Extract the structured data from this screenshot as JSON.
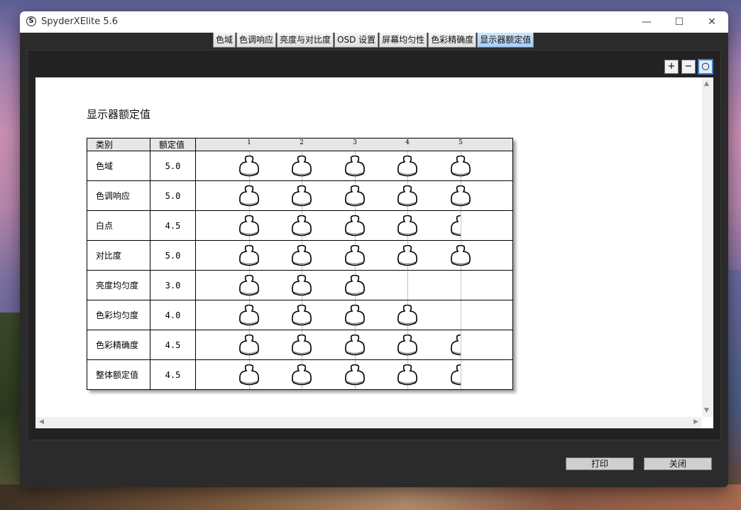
{
  "window": {
    "title": "SpyderXElite 5.6",
    "icon_letter": "S",
    "min_glyph": "—",
    "max_glyph": "☐",
    "close_glyph": "✕"
  },
  "tabs": [
    {
      "label": "色域",
      "active": false
    },
    {
      "label": "色调响应",
      "active": false
    },
    {
      "label": "亮度与对比度",
      "active": false
    },
    {
      "label": "OSD 设置",
      "active": false
    },
    {
      "label": "屏幕均匀性",
      "active": false
    },
    {
      "label": "色彩精确度",
      "active": false
    },
    {
      "label": "显示器额定值",
      "active": true
    }
  ],
  "toolbar": {
    "zoom_in": "+",
    "zoom_out": "−",
    "zoom_fit": "○"
  },
  "report": {
    "title": "显示器额定值",
    "headers": {
      "category": "类别",
      "value": "额定值"
    },
    "scale": [
      "1",
      "2",
      "3",
      "4",
      "5"
    ],
    "rows": [
      {
        "category": "色域",
        "value": "5.0",
        "rating": 5.0
      },
      {
        "category": "色调响应",
        "value": "5.0",
        "rating": 5.0
      },
      {
        "category": "白点",
        "value": "4.5",
        "rating": 4.5
      },
      {
        "category": "对比度",
        "value": "5.0",
        "rating": 5.0
      },
      {
        "category": "亮度均匀度",
        "value": "3.0",
        "rating": 3.0
      },
      {
        "category": "色彩均匀度",
        "value": "4.0",
        "rating": 4.0
      },
      {
        "category": "色彩精确度",
        "value": "4.5",
        "rating": 4.5
      },
      {
        "category": "整体额定值",
        "value": "4.5",
        "rating": 4.5
      }
    ]
  },
  "buttons": {
    "print": "打印",
    "close": "关闭"
  }
}
